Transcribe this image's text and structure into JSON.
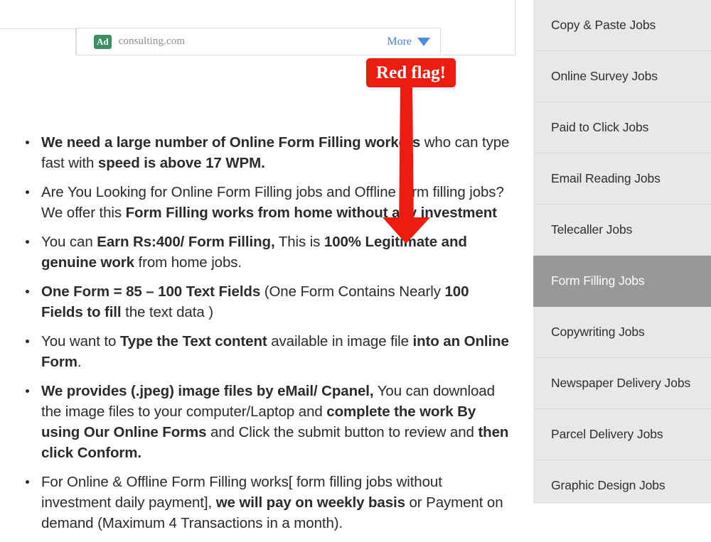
{
  "ad": {
    "badge_label": "Ad",
    "domain": "consulting.com",
    "more_label": "More",
    "caret_icon": "chevron-down-icon",
    "badge_color": "#3c8f60",
    "link_color": "#4a7fd4"
  },
  "annotation": {
    "label": "Red flag!",
    "color": "#ee1b11",
    "arrow_icon": "down-arrow-icon"
  },
  "content": {
    "bullets": [
      {
        "id": "bullet-workers-needed",
        "parts": [
          {
            "text": "We need a large number of Online Form Filling workers",
            "bold": true
          },
          {
            "text": " who can type fast with ",
            "bold": false
          },
          {
            "text": "speed is above 17 WPM.",
            "bold": true
          }
        ]
      },
      {
        "id": "bullet-looking-for-jobs",
        "parts": [
          {
            "text": "Are You Looking for Online Form Filling jobs and Offline form filling jobs? We offer this  ",
            "bold": false
          },
          {
            "text": "Form Filling works from home without any investment",
            "bold": true
          }
        ]
      },
      {
        "id": "bullet-earnings",
        "parts": [
          {
            "text": "You can ",
            "bold": false
          },
          {
            "text": "Earn Rs:400/ Form Filling,",
            "bold": true
          },
          {
            "text": " This is ",
            "bold": false
          },
          {
            "text": "100% Legitimate and genuine work",
            "bold": true
          },
          {
            "text": " from home jobs.",
            "bold": false
          }
        ]
      },
      {
        "id": "bullet-fields-per-form",
        "parts": [
          {
            "text": "One Form = 85 – 100 Text Fields",
            "bold": true
          },
          {
            "text": " (One Form Contains Nearly ",
            "bold": false
          },
          {
            "text": "100 Fields to fill",
            "bold": true
          },
          {
            "text": " the text data )",
            "bold": false
          }
        ]
      },
      {
        "id": "bullet-type-text",
        "parts": [
          {
            "text": "You want to ",
            "bold": false
          },
          {
            "text": "Type the Text content",
            "bold": true
          },
          {
            "text": " available in image file ",
            "bold": false
          },
          {
            "text": "into an Online Form",
            "bold": true
          },
          {
            "text": ".",
            "bold": false
          }
        ]
      },
      {
        "id": "bullet-image-files",
        "parts": [
          {
            "text": "We provides (.jpeg) image files by eMail/ Cpanel,",
            "bold": true
          },
          {
            "text": " You can download the image files to your computer/Laptop and ",
            "bold": false
          },
          {
            "text": "complete the work By using Our Online Forms",
            "bold": true
          },
          {
            "text": " and Click the submit button to review and ",
            "bold": false
          },
          {
            "text": "then click Conform.",
            "bold": true
          }
        ]
      },
      {
        "id": "bullet-payment",
        "parts": [
          {
            "text": "For Online & Offline Form Filling works[ form filling jobs without investment daily payment], ",
            "bold": false
          },
          {
            "text": "we will pay on weekly basis",
            "bold": true
          },
          {
            "text": " or Payment on demand (Maximum 4 Transactions in a month).",
            "bold": false
          }
        ]
      }
    ]
  },
  "sidebar": {
    "active_index": 5,
    "active_bg": "#989898",
    "bg": "#e8e8e8",
    "items": [
      {
        "label": "Copy & Paste Jobs"
      },
      {
        "label": "Online Survey Jobs"
      },
      {
        "label": "Paid to Click Jobs"
      },
      {
        "label": "Email Reading Jobs"
      },
      {
        "label": "Telecaller Jobs"
      },
      {
        "label": "Form Filling Jobs"
      },
      {
        "label": "Copywriting Jobs"
      },
      {
        "label": "Newspaper Delivery Jobs"
      },
      {
        "label": "Parcel Delivery Jobs"
      },
      {
        "label": "Graphic Design Jobs"
      }
    ]
  }
}
